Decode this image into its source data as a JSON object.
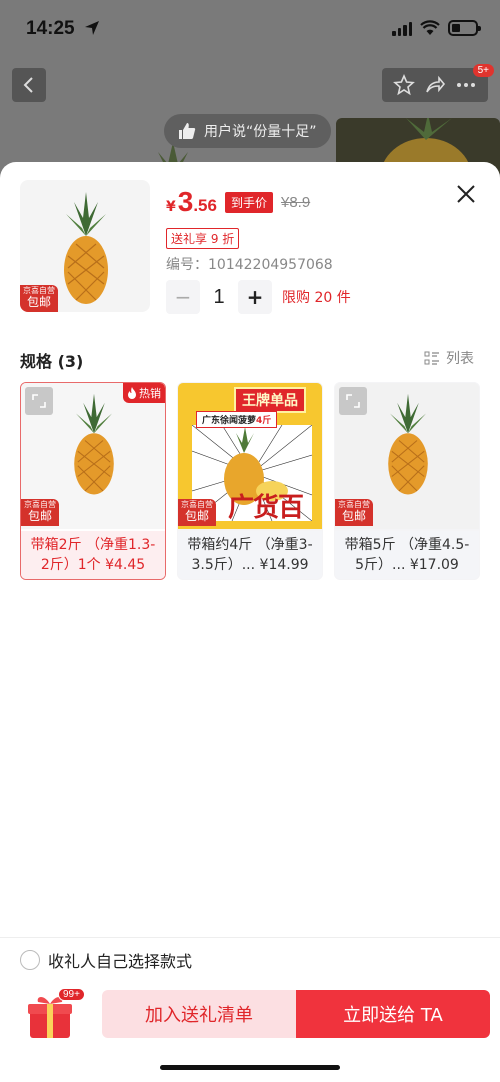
{
  "status": {
    "time": "14:25"
  },
  "background": {
    "review_text": "用户说“份量十足”",
    "badge": "5+"
  },
  "product": {
    "currency": "¥",
    "price_int": "3",
    "price_dec": ".56",
    "price_tag": "到手价",
    "original_price": "¥8.9",
    "gift_discount": "送礼享 9 折",
    "sku_number": "编号：10142204957068",
    "quantity": "1",
    "purchase_limit": "限购 20 件",
    "jd_tag_top": "京喜自营",
    "jd_tag_bottom": "包邮"
  },
  "specs": {
    "title": "规格 (3)",
    "view_toggle": "列表",
    "hot_label": "热销",
    "items": [
      {
        "label": "带箱2斤 （净重1.3-2斤）1个 ¥4.45",
        "selected": true
      },
      {
        "label": "带箱约4斤 （净重3-3.5斤）... ¥14.99",
        "selected": false
      },
      {
        "label": "带箱5斤 （净重4.5-5斤）... ¥17.09",
        "selected": false
      }
    ],
    "promo": {
      "title": "王牌单品",
      "subtitle_prefix": "广东徐闻菠萝",
      "subtitle_highlight": "4斤",
      "big_text": "广货百补"
    }
  },
  "footer": {
    "recipient_option": "收礼人自己选择款式",
    "gift_count": "99+",
    "add_to_list": "加入送礼清单",
    "send_now": "立即送给 TA"
  },
  "colors": {
    "accent": "#e0262a",
    "button_primary": "#f0333d",
    "button_secondary_bg": "#fcdfe2"
  }
}
